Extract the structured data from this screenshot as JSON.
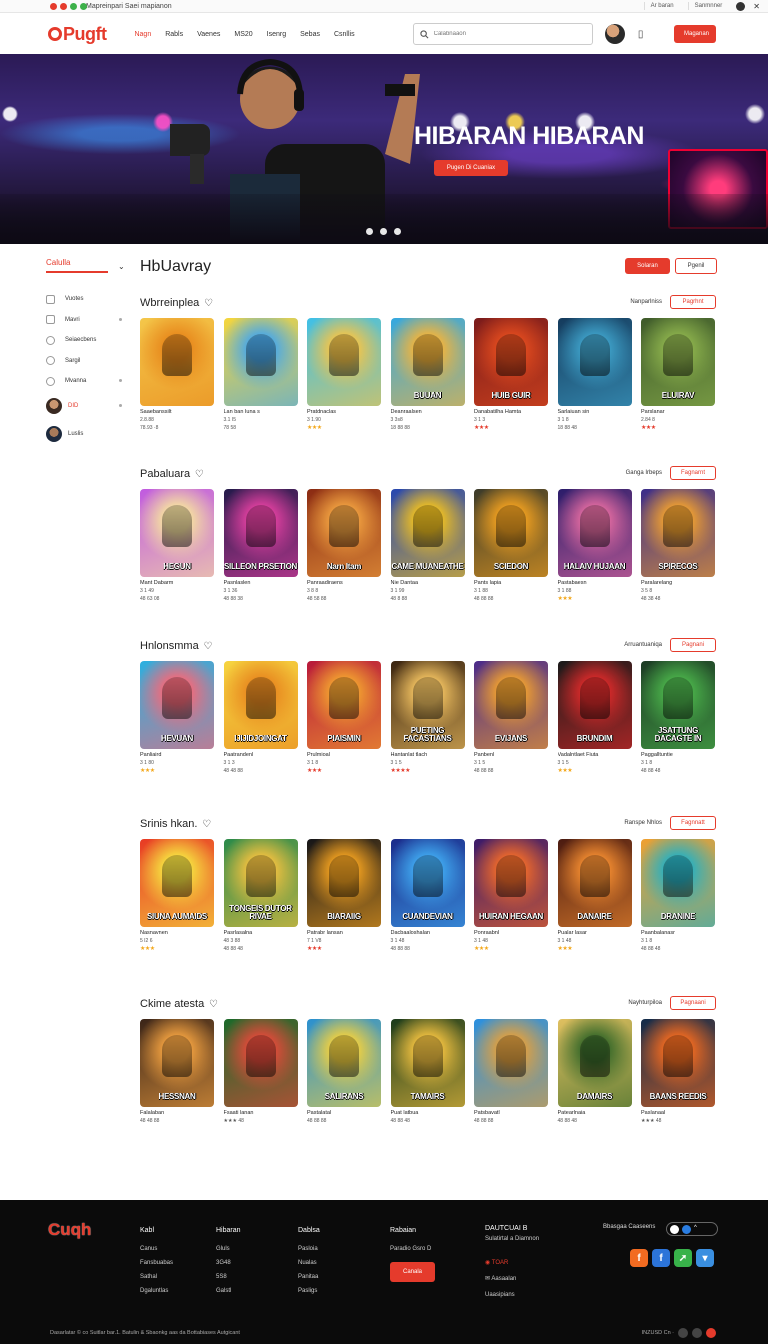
{
  "topbar": {
    "announcement": "Mapreinpari Saei mapianon",
    "link1": "Ar baran",
    "link2": "Sanmnner"
  },
  "header": {
    "logo": "Pugft",
    "nav": [
      "Nagn",
      "Rabls",
      "Vaenes",
      "MS20",
      "Isenrg",
      "Sebas",
      "Csnllis"
    ],
    "search_placeholder": "Calabnaaon",
    "cta": "Maganan"
  },
  "hero": {
    "title": "HIBARAN HIBARAN",
    "cta": "Pugen Di Cuaniax"
  },
  "sidebar": {
    "select_label": "Calulla",
    "items": [
      "Vuotes",
      "Mavri",
      "Seiaecbens",
      "Sargil",
      "Mvanna"
    ],
    "users": [
      {
        "name": "DID",
        "highlight": true
      },
      {
        "name": "Luslis",
        "highlight": false
      }
    ]
  },
  "main": {
    "title": "HbUavray",
    "primary_btn": "Solaran",
    "secondary_btn": "Pgenil"
  },
  "sections": [
    {
      "title": "Wbrreinplea",
      "more": "Nanparlniss",
      "btn": "Pagrhnt",
      "cards": [
        {
          "art": "",
          "name": "Saaebanssilt",
          "sub": "2.8.88",
          "meta": "78.93 ·8",
          "stars": "★★★★",
          "red": false
        },
        {
          "art": "",
          "name": "Lan ban Iuna s",
          "sub": "3.1 I5",
          "meta": "78 58",
          "stars": "",
          "red": false
        },
        {
          "art": "",
          "name": "Pratdnaclas",
          "sub": "3 1.90",
          "meta": "★★★",
          "stars": "",
          "red": false
        },
        {
          "art": "BUUAN",
          "name": "Deanraalsen",
          "sub": "3 3s8",
          "meta": "18 88 88",
          "stars": "",
          "red": false
        },
        {
          "art": "HUIB GUIR",
          "name": "Danabatilha Hamta",
          "sub": "3 1 3",
          "meta": "★★★",
          "stars": "",
          "red": true
        },
        {
          "art": "",
          "name": "Sarlaiuan sin",
          "sub": "3 1 8",
          "meta": "18 88 48",
          "stars": "",
          "red": false
        },
        {
          "art": "ELUIRAV",
          "name": "Parslanar",
          "sub": "2.84 8",
          "meta": "★★★",
          "stars": "",
          "red": true
        }
      ]
    },
    {
      "title": "Pabaluara",
      "more": "Ganga Irbeps",
      "btn": "Fagnarnt",
      "cards": [
        {
          "art": "HEGUN",
          "name": "Mant Dabarm",
          "sub": "3 1 49",
          "meta": "48 63 08",
          "stars": "",
          "red": false
        },
        {
          "art": "SILLEON PRSETION",
          "name": "Pasnlaslen",
          "sub": "3 1 36",
          "meta": "48 88 38",
          "stars": "",
          "red": false
        },
        {
          "art": "Narn Itam",
          "name": "Panraadiraens",
          "sub": "3 8 8",
          "meta": "48 58 88",
          "stars": "",
          "red": false
        },
        {
          "art": "CAME MUANEATHE",
          "name": "Nie Dantaa",
          "sub": "3 1 99",
          "meta": "48 8 88",
          "stars": "",
          "red": false
        },
        {
          "art": "SCIEDON",
          "name": "Pants lapia",
          "sub": "3 1 88",
          "meta": "48 88 88",
          "stars": "",
          "red": false
        },
        {
          "art": "HALAIV HUJAAN",
          "name": "Pastabaesn",
          "sub": "3 1 88",
          "meta": "★★★",
          "stars": "",
          "red": false
        },
        {
          "art": "SPIRECOS",
          "name": "Paralarelang",
          "sub": "3 5 8",
          "meta": "48 38 48",
          "stars": "",
          "red": false
        }
      ]
    },
    {
      "title": "Hnlonsmma",
      "more": "Arruantuaniqa",
      "btn": "Pagnani",
      "cards": [
        {
          "art": "HEVUAN",
          "name": "Panliaird",
          "sub": "3 1 80",
          "meta": "★★★",
          "stars": "",
          "red": false
        },
        {
          "art": "IJIJIDJOINGAT",
          "name": "Paatrandenl",
          "sub": "3 1 3",
          "meta": "48 48 88",
          "stars": "",
          "red": false
        },
        {
          "art": "PIAISMIN",
          "name": "Prulmioal",
          "sub": "3 1 8",
          "meta": "★★★",
          "stars": "",
          "red": true
        },
        {
          "art": "PUETING FACASTIANS",
          "name": "Hantanlat tlach",
          "sub": "3 1 5",
          "meta": "★★★★",
          "stars": "",
          "red": true
        },
        {
          "art": "EVIJANS",
          "name": "Panbenl",
          "sub": "3 1 5",
          "meta": "48 88 88",
          "stars": "",
          "red": false
        },
        {
          "art": "BRUNDIM",
          "name": "Vadalntlaet Fiuta",
          "sub": "3 1 5",
          "meta": "★★★",
          "stars": "",
          "red": false
        },
        {
          "art": "JSATTUNG DACAGTE IN",
          "name": "Paggalltuntie",
          "sub": "3 1 8",
          "meta": "48 88 48",
          "stars": "",
          "red": false
        }
      ]
    },
    {
      "title": "Srinis hkan.",
      "more": "Ranspe Nhlos",
      "btn": "Fagnnatt",
      "cards": [
        {
          "art": "SIUNA AUMAIDS",
          "name": "Nasnavnen",
          "sub": "5 I2 6",
          "meta": "★★★",
          "stars": "",
          "red": false
        },
        {
          "art": "TONGEIS DUTOR RIVAE",
          "name": "Pasrlasalna",
          "sub": "48 3 88",
          "meta": "48 88 48",
          "stars": "",
          "red": false
        },
        {
          "art": "BIARAIIG",
          "name": "Patrabr lansan",
          "sub": "7 1 V8",
          "meta": "★★★",
          "stars": "",
          "red": true
        },
        {
          "art": "CUANDEVIAN",
          "name": "Dacbaaloshalan",
          "sub": "3 1 48",
          "meta": "48 88 88",
          "stars": "",
          "red": false
        },
        {
          "art": "HUIRAN HEGAAN",
          "name": "Ponraabnl",
          "sub": "3 1 48",
          "meta": "★★★",
          "stars": "",
          "red": false
        },
        {
          "art": "DANAIRE",
          "name": "Pualar lasar",
          "sub": "3 1 48",
          "meta": "★★★",
          "stars": "",
          "red": false
        },
        {
          "art": "DRANINE",
          "name": "Paanbalanasr",
          "sub": "3 1 8",
          "meta": "48 88 48",
          "stars": "",
          "red": false
        }
      ]
    },
    {
      "title": "Ckime atesta",
      "more": "Nayhturpiloa",
      "btn": "Pagnaani",
      "cards": [
        {
          "art": "HESSNAN",
          "name": "Falalaban",
          "sub": "48 48 88",
          "meta": "",
          "stars": "",
          "red": false
        },
        {
          "art": "",
          "name": "Fsaati lanan",
          "sub": "★★★ 48",
          "meta": "",
          "stars": "",
          "red": false
        },
        {
          "art": "SALIRANS",
          "name": "Pastalatal",
          "sub": "48 88 88",
          "meta": "",
          "stars": "",
          "red": false
        },
        {
          "art": "TAMAIRS",
          "name": "Puat latbua",
          "sub": "48 88 48",
          "meta": "",
          "stars": "",
          "red": false
        },
        {
          "art": "",
          "name": "Patsbavatl",
          "sub": "48 88 88",
          "meta": "",
          "stars": "",
          "red": false
        },
        {
          "art": "DAMAIRS",
          "name": "Patearlnaia",
          "sub": "48 88 48",
          "meta": "",
          "stars": "",
          "red": false
        },
        {
          "art": "BAANS REEDIS",
          "name": "Paslanaal",
          "sub": "★★★ 48",
          "meta": "",
          "stars": "",
          "red": false
        }
      ]
    }
  ],
  "footer": {
    "logo": "Cuqh",
    "cols": [
      {
        "heading": "Kabl",
        "items": [
          "Canus",
          "Fansbuabas",
          "Sathal",
          "Dgaluntlas"
        ]
      },
      {
        "heading": "Hibaran",
        "items": [
          "Gluls",
          "3G48",
          "5S8",
          "Galstl"
        ]
      },
      {
        "heading": "Dablsa",
        "items": [
          "Pasloia",
          "Nualas",
          "Panitaa",
          "Pasligs"
        ]
      },
      {
        "heading": "Rabaian",
        "items": [
          "Paradio Gsro D"
        ],
        "btn": "Canala"
      }
    ],
    "contact": {
      "heading": "DAUTCUAI B",
      "sub": "Sulatirtal a Diamnon",
      "phone": "TOAR",
      "mail": "Aasaalan",
      "web": "Uaasipians"
    },
    "social_label": "Bbasgaa Caaseens",
    "bottom": "Dasarlatar © co Suitlar bar.1. Batulin & Sbaonkg aas da Bottabiases Autgicant",
    "bottom_right": "INZUSD Cn ·"
  },
  "colors": {
    "accent": "#e53b2c",
    "footer_bg": "#0b0b0b",
    "star": "#f3a81c"
  }
}
